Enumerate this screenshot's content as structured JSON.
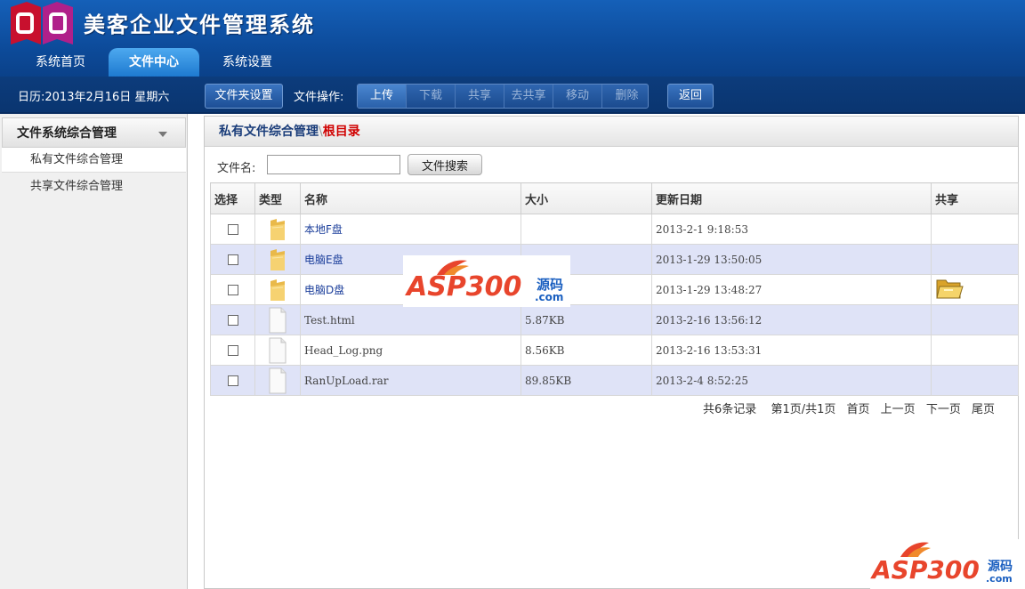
{
  "app": {
    "title": "美客企业文件管理系统"
  },
  "tabs": [
    {
      "label": "系统首页"
    },
    {
      "label": "文件中心"
    },
    {
      "label": "系统设置"
    }
  ],
  "toolbar": {
    "date": "日历:2013年2月16日  星期六",
    "folder_settings": "文件夹设置",
    "ops_label": "文件操作:",
    "ops": [
      "上传",
      "下载",
      "共享",
      "去共享",
      "移动",
      "删除"
    ],
    "back": "返回"
  },
  "sidebar": {
    "header": "文件系统综合管理",
    "items": [
      "私有文件综合管理",
      "共享文件综合管理"
    ]
  },
  "main": {
    "title": "私有文件综合管理",
    "separator": "\\",
    "root": "根目录",
    "search_label": "文件名:",
    "search_value": "",
    "search_button": "文件搜索",
    "columns": [
      "选择",
      "类型",
      "名称",
      "大小",
      "更新日期",
      "共享"
    ],
    "rows": [
      {
        "type": "folder",
        "name": "本地F盘",
        "size": "",
        "date": "2013-2-1 9:18:53",
        "shared": false
      },
      {
        "type": "folder",
        "name": "电脑E盘",
        "size": "",
        "date": "2013-1-29 13:50:05",
        "shared": false
      },
      {
        "type": "folder",
        "name": "电脑D盘",
        "size": "",
        "date": "2013-1-29 13:48:27",
        "shared": true
      },
      {
        "type": "file",
        "name": "Test.html",
        "size": "5.87KB",
        "date": "2013-2-16 13:56:12",
        "shared": false
      },
      {
        "type": "file",
        "name": "Head_Log.png",
        "size": "8.56KB",
        "date": "2013-2-16 13:53:31",
        "shared": false
      },
      {
        "type": "file",
        "name": "RanUpLoad.rar",
        "size": "89.85KB",
        "date": "2013-2-4 8:52:25",
        "shared": false
      }
    ],
    "pager": {
      "records": "共6条记录",
      "page_info": "第1页/共1页",
      "first": "首页",
      "prev": "上一页",
      "next": "下一页",
      "last": "尾页"
    }
  },
  "watermark": {
    "brand": "ASP300",
    "cn": "源码",
    "dotcom": ".com"
  },
  "colors": {
    "header_blue": "#0d4c9c",
    "active_tab": "#1e7ad0",
    "row_alt": "#dfe3f7",
    "root_red": "#d00000"
  }
}
